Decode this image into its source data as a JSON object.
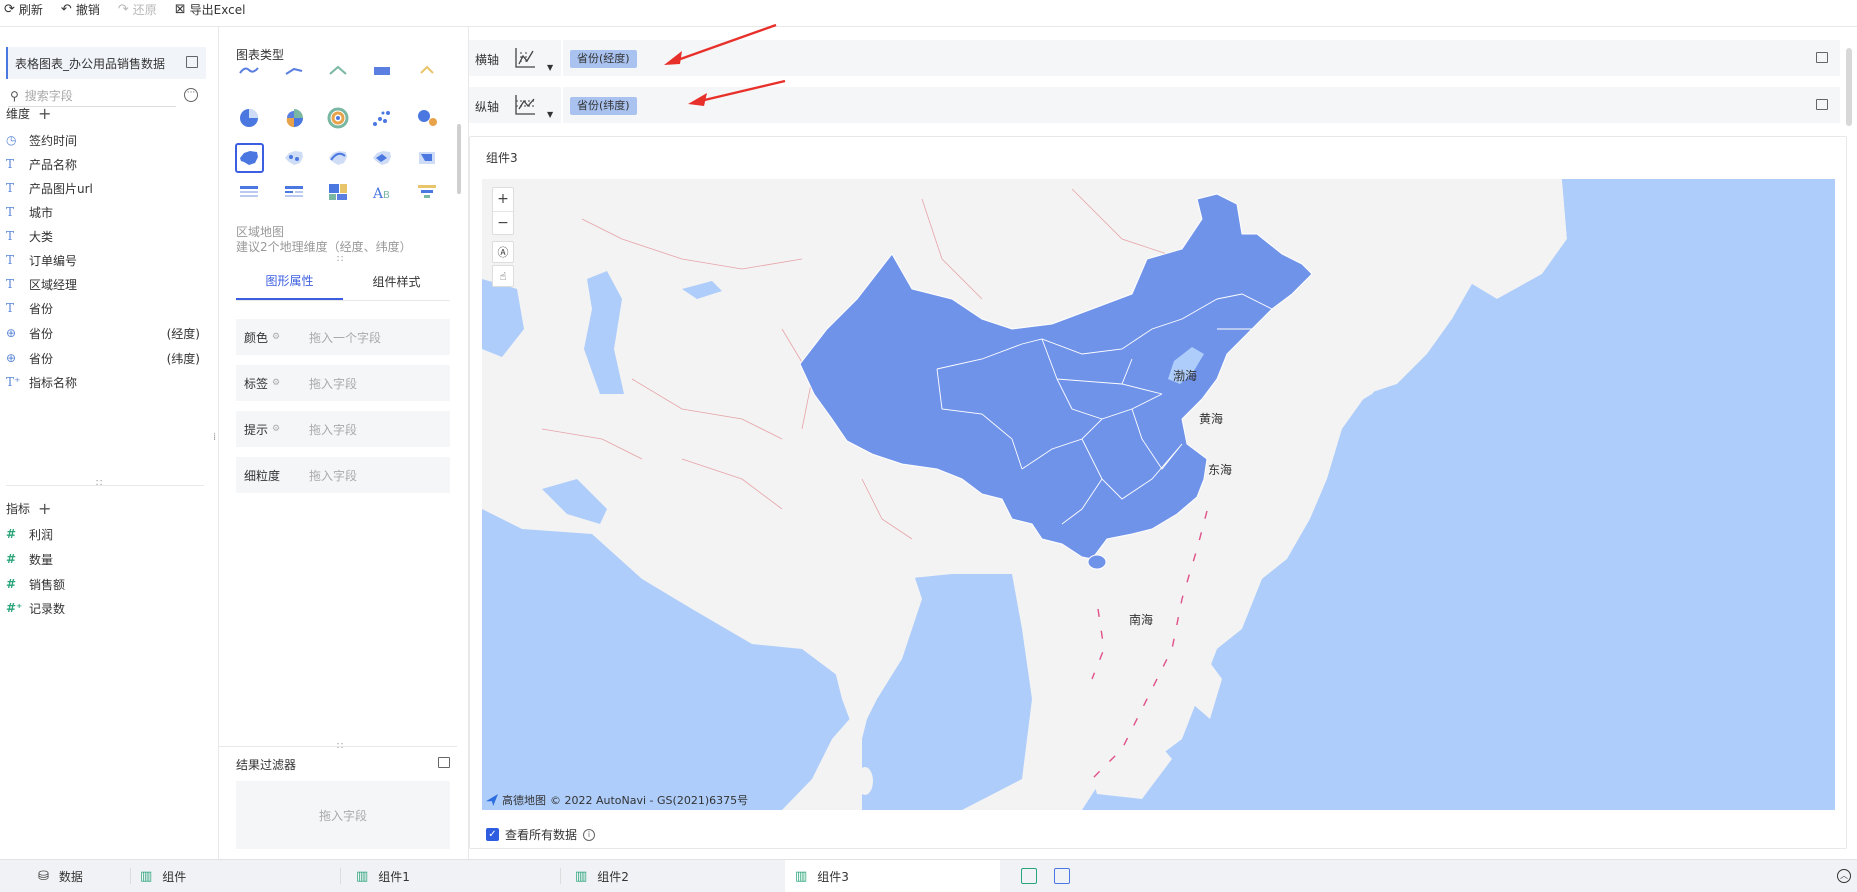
{
  "toolbar": {
    "refresh": "刷新",
    "undo": "撤销",
    "redo": "还原",
    "export": "导出Excel"
  },
  "left": {
    "dataset": "表格图表_办公用品销售数据",
    "search_placeholder": "搜索字段",
    "dimensions_title": "维度",
    "dimensions": [
      {
        "icon": "clock-icon",
        "label": "签约时间",
        "suffix": ""
      },
      {
        "icon": "text-icon",
        "label": "产品名称",
        "suffix": ""
      },
      {
        "icon": "text-icon",
        "label": "产品图片url",
        "suffix": ""
      },
      {
        "icon": "text-icon",
        "label": "城市",
        "suffix": ""
      },
      {
        "icon": "text-icon",
        "label": "大类",
        "suffix": ""
      },
      {
        "icon": "text-icon",
        "label": "订单编号",
        "suffix": ""
      },
      {
        "icon": "text-icon",
        "label": "区域经理",
        "suffix": ""
      },
      {
        "icon": "text-icon",
        "label": "省份",
        "suffix": ""
      },
      {
        "icon": "globe-icon",
        "label": "省份",
        "suffix": "(经度)"
      },
      {
        "icon": "globe-icon",
        "label": "省份",
        "suffix": "(纬度)"
      },
      {
        "icon": "text-plus-icon",
        "label": "指标名称",
        "suffix": ""
      }
    ],
    "measures_title": "指标",
    "measures": [
      {
        "icon": "hash-icon",
        "label": "利润"
      },
      {
        "icon": "hash-icon",
        "label": "数量"
      },
      {
        "icon": "hash-icon",
        "label": "销售额"
      },
      {
        "icon": "hash-plus-icon",
        "label": "记录数"
      }
    ]
  },
  "chart_panel": {
    "title": "图表类型",
    "selected_type": "区域地图",
    "selected_desc": "建议2个地理维度（经度、纬度）",
    "tabs": [
      "图形属性",
      "组件样式"
    ],
    "active_tab": 0,
    "properties": [
      {
        "label": "颜色",
        "placeholder": "拖入一个字段"
      },
      {
        "label": "标签",
        "placeholder": "拖入字段"
      },
      {
        "label": "提示",
        "placeholder": "拖入字段"
      },
      {
        "label": "细粒度",
        "placeholder": "拖入字段"
      }
    ],
    "result_filter": "结果过滤器",
    "result_filter_placeholder": "拖入字段"
  },
  "axes": {
    "x_label": "横轴",
    "x_field": "省份(经度)",
    "y_label": "纵轴",
    "y_field": "省份(纬度)"
  },
  "component": {
    "title": "组件3",
    "seas": [
      "渤海",
      "黄海",
      "东海",
      "南海"
    ],
    "copyright_brand": "高德地图",
    "copyright": "© 2022 AutoNavi - GS(2021)6375号",
    "view_all": "查看所有数据",
    "colors": {
      "highlight": "#7093ea",
      "land": "#f3f3f3",
      "water": "#aecdfa",
      "accent": "#3b5fe0"
    }
  },
  "bottom_tabs": [
    "数据",
    "组件",
    "组件1",
    "组件2",
    "组件3"
  ],
  "active_bottom_tab": 4
}
